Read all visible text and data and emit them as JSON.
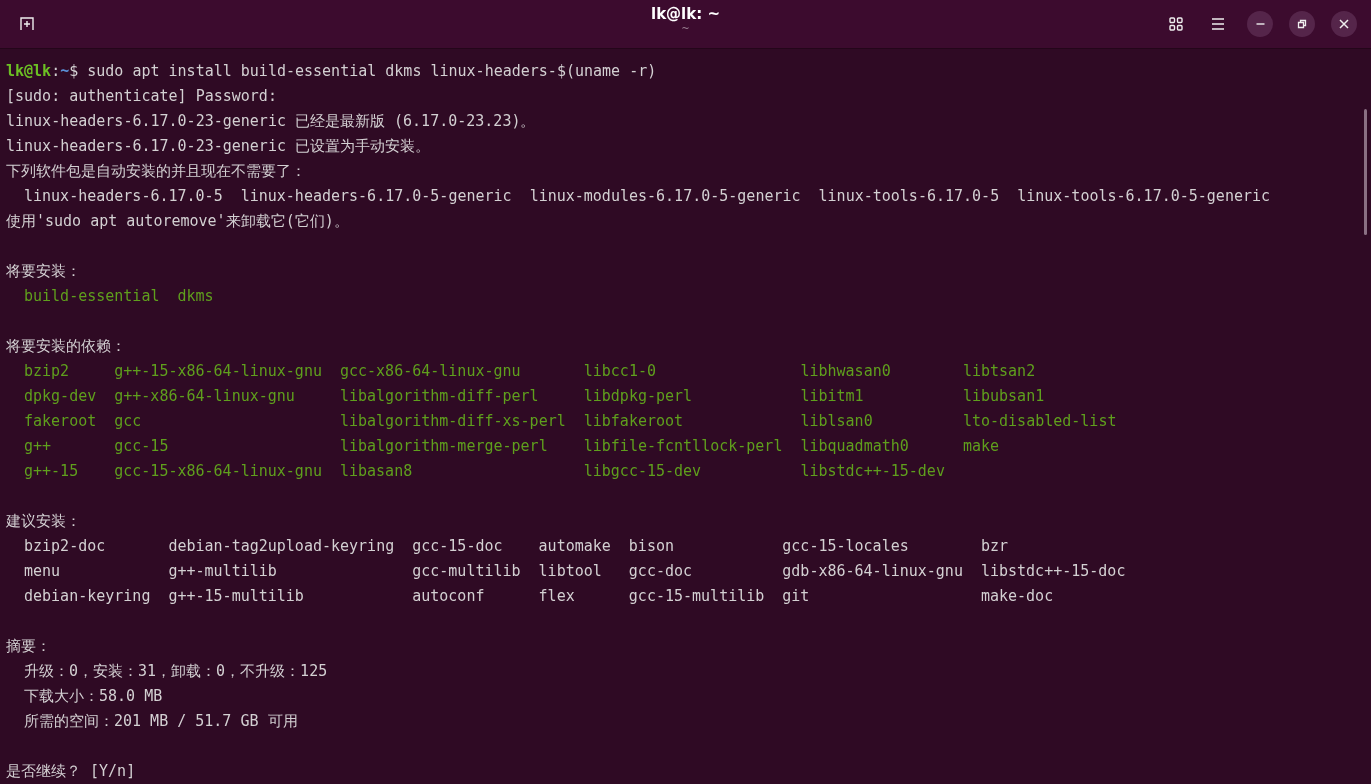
{
  "window": {
    "title": "lk@lk: ~",
    "subtitle": "~"
  },
  "terminal": {
    "blocks": [
      {
        "kind": "prompt",
        "user": "lk@lk",
        "separator": ":",
        "path": "~",
        "command": "$ sudo apt install build-essential dkms linux-headers-$(uname -r)"
      },
      {
        "kind": "text",
        "text": "[sudo: authenticate] Password:",
        "indented": false
      },
      {
        "kind": "text",
        "text": "linux-headers-6.17.0-23-generic 已经是最新版 (6.17.0-23.23)。",
        "indented": false
      },
      {
        "kind": "text",
        "text": "linux-headers-6.17.0-23-generic 已设置为手动安装。",
        "indented": false
      },
      {
        "kind": "text",
        "text": "下列软件包是自动安装的并且现在不需要了：",
        "indented": false
      },
      {
        "kind": "packages",
        "new": false,
        "rows": [
          [
            "linux-headers-6.17.0-5",
            "linux-headers-6.17.0-5-generic",
            "linux-modules-6.17.0-5-generic",
            "linux-tools-6.17.0-5",
            "linux-tools-6.17.0-5-generic"
          ]
        ]
      },
      {
        "kind": "text",
        "text": "使用'sudo apt autoremove'来卸载它(它们)。",
        "indented": false
      },
      {
        "kind": "blank"
      },
      {
        "kind": "text",
        "text": "将要安装：",
        "indented": false
      },
      {
        "kind": "packages",
        "new": true,
        "rows": [
          [
            "build-essential",
            "dkms"
          ]
        ]
      },
      {
        "kind": "blank"
      },
      {
        "kind": "text",
        "text": "将要安装的依赖：",
        "indented": false
      },
      {
        "kind": "packages",
        "new": true,
        "rows": [
          [
            "bzip2",
            "g++-15-x86-64-linux-gnu",
            "gcc-x86-64-linux-gnu",
            "libcc1-0",
            "libhwasan0",
            "libtsan2"
          ],
          [
            "dpkg-dev",
            "g++-x86-64-linux-gnu",
            "libalgorithm-diff-perl",
            "libdpkg-perl",
            "libitm1",
            "libubsan1"
          ],
          [
            "fakeroot",
            "gcc",
            "libalgorithm-diff-xs-perl",
            "libfakeroot",
            "liblsan0",
            "lto-disabled-list"
          ],
          [
            "g++",
            "gcc-15",
            "libalgorithm-merge-perl",
            "libfile-fcntllock-perl",
            "libquadmath0",
            "make"
          ],
          [
            "g++-15",
            "gcc-15-x86-64-linux-gnu",
            "libasan8",
            "libgcc-15-dev",
            "libstdc++-15-dev"
          ]
        ]
      },
      {
        "kind": "blank"
      },
      {
        "kind": "text",
        "text": "建议安装：",
        "indented": false
      },
      {
        "kind": "packages",
        "new": false,
        "rows": [
          [
            "bzip2-doc",
            "debian-tag2upload-keyring",
            "gcc-15-doc",
            "automake",
            "bison",
            "gcc-15-locales",
            "bzr"
          ],
          [
            "menu",
            "g++-multilib",
            "gcc-multilib",
            "libtool",
            "gcc-doc",
            "gdb-x86-64-linux-gnu",
            "libstdc++-15-doc"
          ],
          [
            "debian-keyring",
            "g++-15-multilib",
            "autoconf",
            "flex",
            "gcc-15-multilib",
            "git",
            "make-doc"
          ]
        ]
      },
      {
        "kind": "blank"
      },
      {
        "kind": "text",
        "text": "摘要：",
        "indented": false
      },
      {
        "kind": "text",
        "text": "升级：0，安装：31，卸载：0，不升级：125",
        "indented": true
      },
      {
        "kind": "text",
        "text": "下载大小：58.0 MB",
        "indented": true
      },
      {
        "kind": "text",
        "text": "所需的空间：201 MB / 51.7 GB 可用",
        "indented": true
      },
      {
        "kind": "blank"
      },
      {
        "kind": "text",
        "text": "是否继续？ [Y/n]",
        "indented": false
      }
    ]
  }
}
